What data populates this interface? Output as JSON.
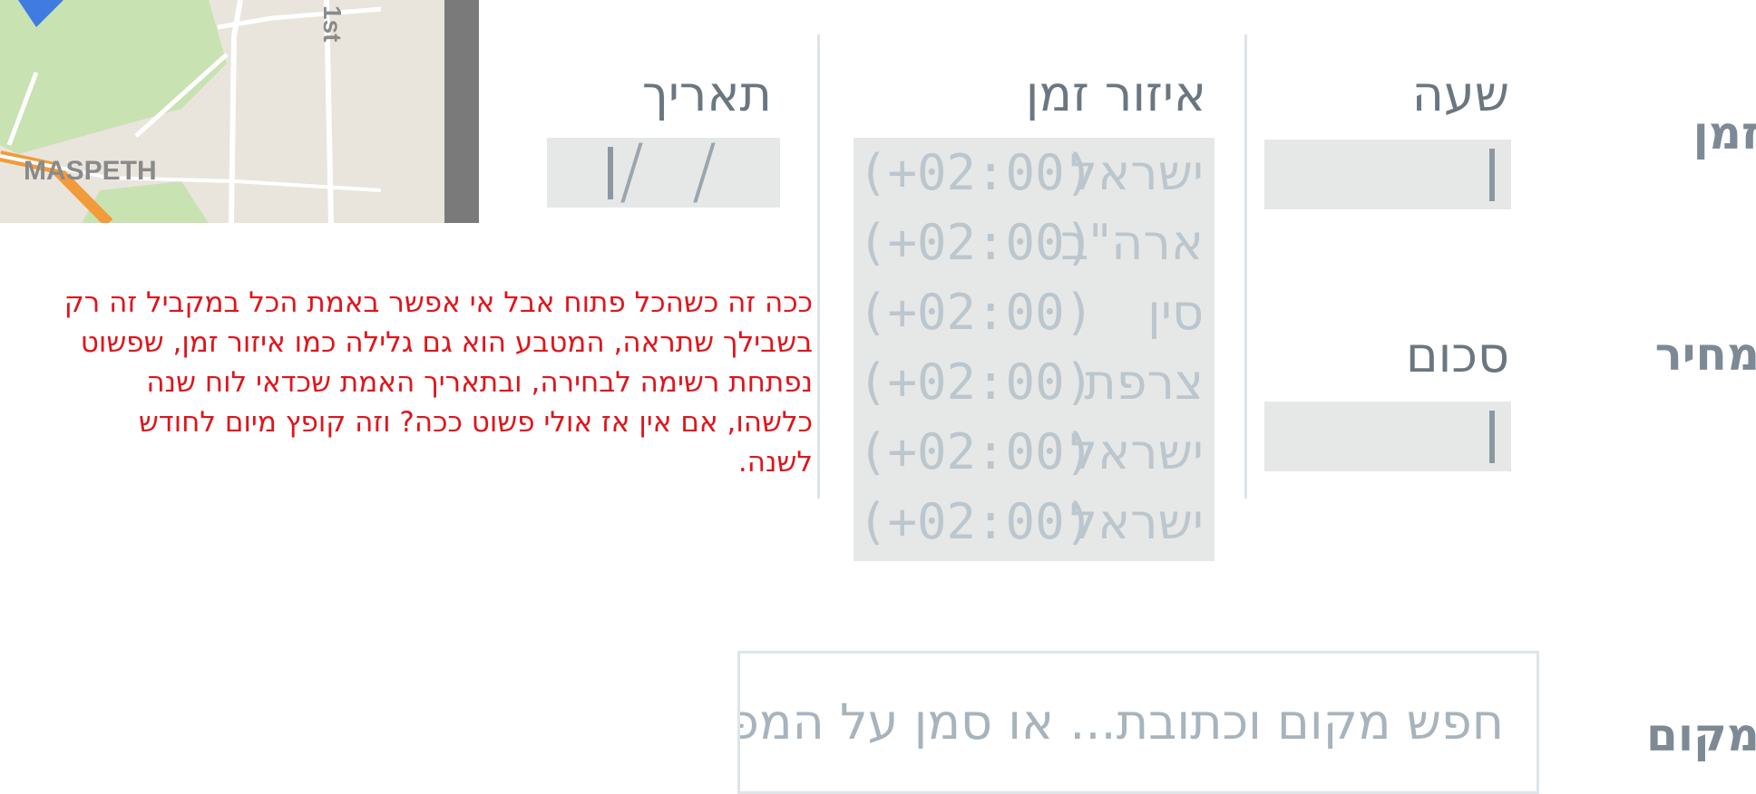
{
  "sections": {
    "time_label": "זמן",
    "price_label": "מחיר",
    "location_label": "מקום"
  },
  "time": {
    "hour_heading": "שעה",
    "timezone_heading": "איזור זמן",
    "date_heading": "תאריך",
    "hour_value": "",
    "date_separators": [
      "/",
      "/"
    ],
    "timezones": [
      {
        "name": "ישראל",
        "offset": "(+02:00)"
      },
      {
        "name": "ארה\"ב",
        "offset": "(+02:00)"
      },
      {
        "name": "סין",
        "offset": "(+02:00)"
      },
      {
        "name": "צרפת",
        "offset": "(+02:00)"
      },
      {
        "name": "ישראל",
        "offset": "(+02:00)"
      },
      {
        "name": "ישראל",
        "offset": "(+02:00)"
      }
    ]
  },
  "price": {
    "amount_heading": "סכום",
    "amount_value": ""
  },
  "location": {
    "search_placeholder": "חפש מקום וכתובת... או סמן על המפה"
  },
  "map": {
    "area_label": "MASPETH",
    "street_label": "1st"
  },
  "annotation": {
    "text": "ככה זה כשהכל פתוח אבל אי אפשר באמת הכל במקביל זה רק בשבילך שתראה, המטבע הוא גם גלילה כמו איזור זמן, שפשוט נפתחת רשימה לבחירה, ובתאריך האמת שכדאי לוח שנה כלשהו, אם אין אז אולי פשוט ככה? וזה קופץ מיום לחודש לשנה."
  },
  "colors": {
    "section_label": "#7d8a95",
    "heading": "#6b7780",
    "input_bg": "#e6e8e8",
    "annotation": "#e0141b",
    "placeholder": "#a7b4bd"
  }
}
